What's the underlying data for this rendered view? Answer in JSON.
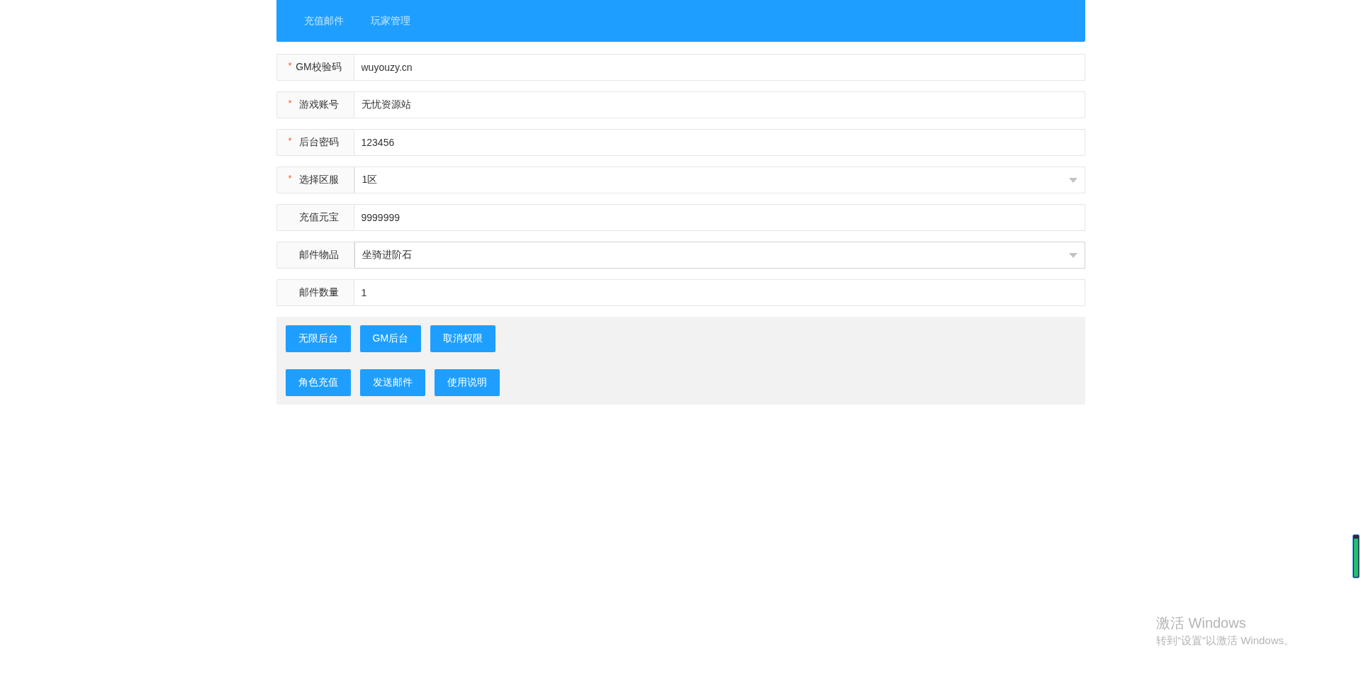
{
  "nav": {
    "items": [
      "充值邮件",
      "玩家管理"
    ]
  },
  "form": {
    "fields": [
      {
        "label": "GM校验码",
        "marker": "*",
        "kind": "text",
        "value": "wuyouzy.cn"
      },
      {
        "label": "游戏账号",
        "marker": "*",
        "kind": "text",
        "value": "无忧资源站"
      },
      {
        "label": "后台密码",
        "marker": "*",
        "kind": "text",
        "value": "123456"
      },
      {
        "label": "选择区服",
        "marker": "*",
        "kind": "select",
        "value": "1区"
      },
      {
        "label": "充值元宝",
        "kind": "text",
        "value": "9999999"
      },
      {
        "label": "邮件物品",
        "kind": "select",
        "value": "坐骑进阶石"
      },
      {
        "label": "邮件数量",
        "kind": "text",
        "value": "1"
      }
    ]
  },
  "actions": [
    [
      "无限后台",
      "GM后台",
      "取消权限"
    ],
    [
      "角色充值",
      "发送邮件",
      "使用说明"
    ]
  ],
  "activation_notice": {
    "title": "激活 Windows",
    "subtitle": "转到“设置”以激活 Windows。"
  }
}
